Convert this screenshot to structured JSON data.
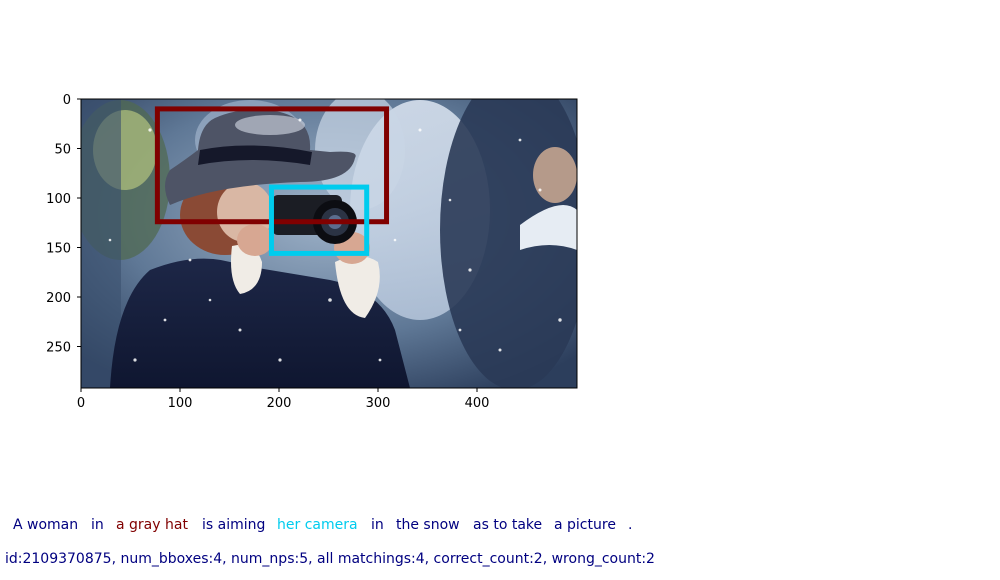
{
  "colors": {
    "box_1": "#800000",
    "box_2": "#00ccee",
    "plain_text": "#000080"
  },
  "image": {
    "subject": "woman in a gray hat aiming a camera in the snow",
    "width": 500,
    "height": 292
  },
  "axes": {
    "x_ticks": [
      "0",
      "100",
      "200",
      "300",
      "400"
    ],
    "y_ticks": [
      "0",
      "50",
      "100",
      "150",
      "200",
      "250"
    ]
  },
  "boxes": [
    {
      "label": "a gray hat",
      "color": "#800000",
      "x1": 77,
      "y1": 10,
      "x2": 308,
      "y2": 124
    },
    {
      "label": "her camera",
      "color": "#00ccee",
      "x1": 192,
      "y1": 89,
      "x2": 288,
      "y2": 156
    }
  ],
  "sentence": [
    {
      "text": "A woman",
      "color": "#000080"
    },
    {
      "text": "in",
      "color": "#000080"
    },
    {
      "text": "a gray hat",
      "color": "#800000"
    },
    {
      "text": "is aiming",
      "color": "#000080"
    },
    {
      "text": "her camera",
      "color": "#00ccee"
    },
    {
      "text": "in",
      "color": "#000080"
    },
    {
      "text": "the snow",
      "color": "#000080"
    },
    {
      "text": "as to take",
      "color": "#000080"
    },
    {
      "text": "a picture",
      "color": "#000080"
    },
    {
      "text": ".",
      "color": "#000080"
    }
  ],
  "info": "id:2109370875, num_bboxes:4, num_nps:5, all matchings:4, correct_count:2, wrong_count:2"
}
